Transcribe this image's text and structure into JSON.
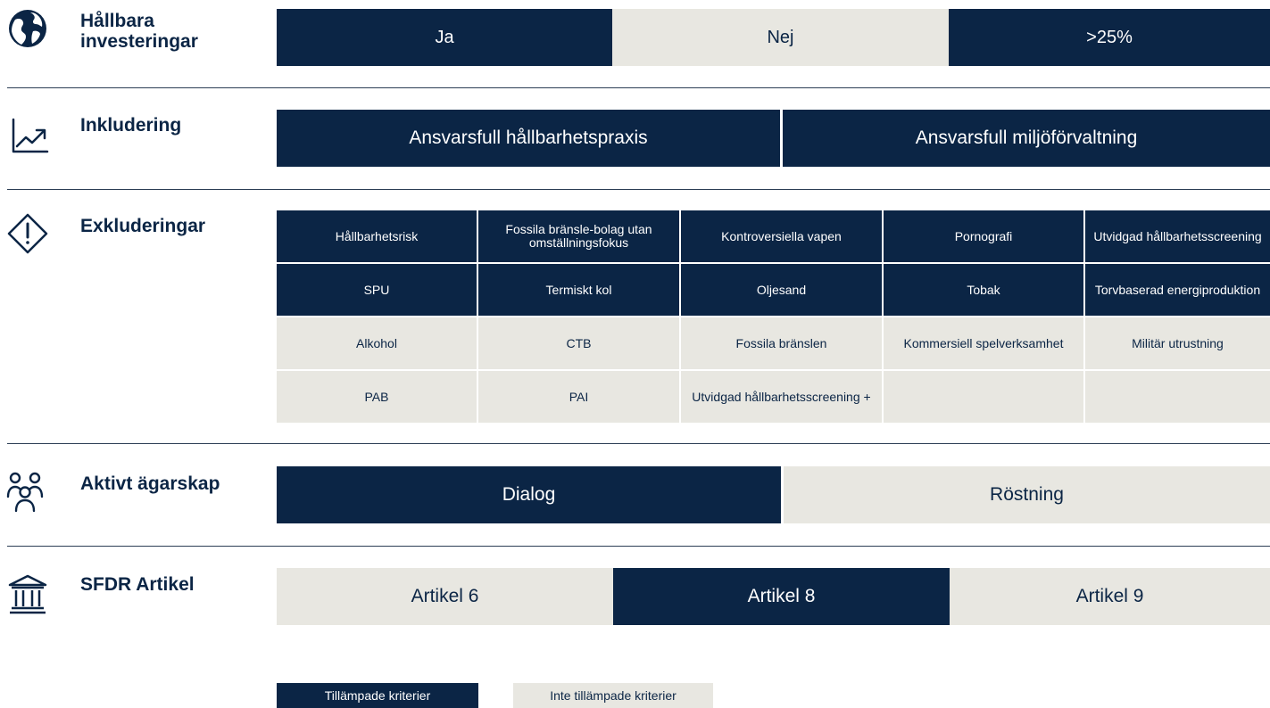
{
  "colors": {
    "applied": "#0b2545",
    "not_applied": "#e8e7e1"
  },
  "sustainable": {
    "label": "Hållbara investeringar",
    "icon": "globe-icon",
    "options": [
      {
        "label": "Ja",
        "applied": true
      },
      {
        "label": "Nej",
        "applied": false
      },
      {
        "label": ">25%",
        "applied": true
      }
    ]
  },
  "inclusion": {
    "label": "Inkludering",
    "icon": "trend-up-icon",
    "options": [
      {
        "label": "Ansvarsfull hållbarhetspraxis",
        "applied": true
      },
      {
        "label": "Ansvarsfull miljöförvaltning",
        "applied": true
      }
    ]
  },
  "exclusions": {
    "label": "Exkluderingar",
    "icon": "warning-diamond-icon",
    "items": [
      {
        "label": "Hållbarhetsrisk",
        "applied": true
      },
      {
        "label": "Fossila bränsle-bolag utan omställningsfokus",
        "applied": true
      },
      {
        "label": "Kontroversiella vapen",
        "applied": true
      },
      {
        "label": "Pornografi",
        "applied": true
      },
      {
        "label": "Utvidgad hållbarhetsscreening",
        "applied": true
      },
      {
        "label": "SPU",
        "applied": true
      },
      {
        "label": "Termiskt kol",
        "applied": true
      },
      {
        "label": "Oljesand",
        "applied": true
      },
      {
        "label": "Tobak",
        "applied": true
      },
      {
        "label": "Torvbaserad energiproduktion",
        "applied": true
      },
      {
        "label": "Alkohol",
        "applied": false
      },
      {
        "label": "CTB",
        "applied": false
      },
      {
        "label": "Fossila bränslen",
        "applied": false
      },
      {
        "label": "Kommersiell spelverksamhet",
        "applied": false
      },
      {
        "label": "Militär utrustning",
        "applied": false
      },
      {
        "label": "PAB",
        "applied": false
      },
      {
        "label": "PAI",
        "applied": false
      },
      {
        "label": "Utvidgad hållbarhetsscreening +",
        "applied": false
      },
      {
        "label": "",
        "applied": false
      },
      {
        "label": "",
        "applied": false
      }
    ]
  },
  "ownership": {
    "label": "Aktivt ägarskap",
    "icon": "people-group-icon",
    "options": [
      {
        "label": "Dialog",
        "applied": true
      },
      {
        "label": "Röstning",
        "applied": false
      }
    ]
  },
  "sfdr": {
    "label": "SFDR Artikel",
    "icon": "bank-building-icon",
    "options": [
      {
        "label": "Artikel 6",
        "applied": false
      },
      {
        "label": "Artikel 8",
        "applied": true
      },
      {
        "label": "Artikel 9",
        "applied": false
      }
    ]
  },
  "legend": {
    "applied": "Tillämpade kriterier",
    "not_applied": "Inte tillämpade kriterier"
  }
}
